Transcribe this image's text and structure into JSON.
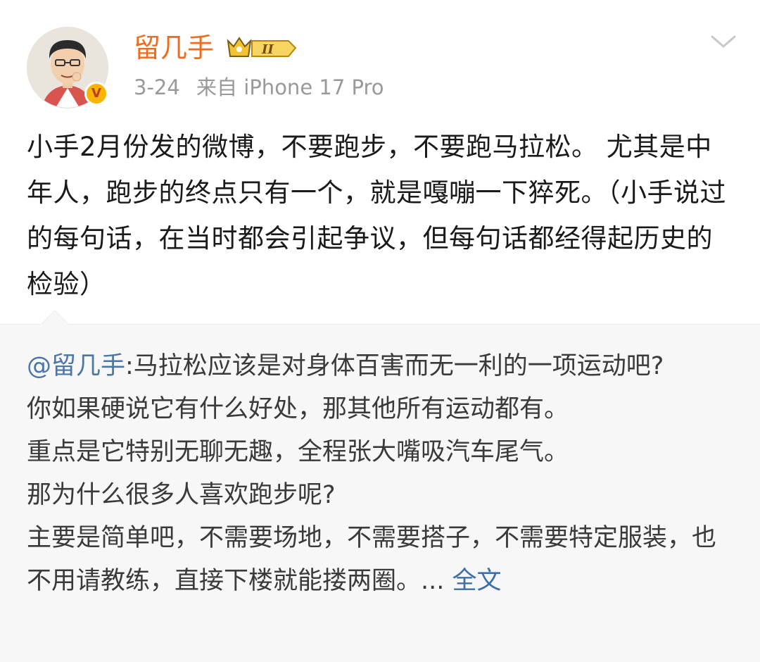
{
  "post": {
    "username": "留几手",
    "vip_level": "II",
    "verified_mark": "V",
    "date": "3-24",
    "source": "来自 iPhone 17 Pro",
    "body": "小手2月份发的微博，不要跑步，不要跑马拉松。 尤其是中年人，跑步的终点只有一个，就是嘎嘣一下猝死。（小手说过的每句话，在当时都会引起争议，但每句话都经得起历史的检验）"
  },
  "quote": {
    "mention": "@留几手",
    "lines": [
      ":马拉松应该是对身体百害而无一利的一项运动吧?",
      "你如果硬说它有什么好处，那其他所有运动都有。",
      "重点是它特别无聊无趣，全程张大嘴吸汽车尾气。",
      "那为什么很多人喜欢跑步呢?",
      "主要是简单吧，不需要场地，不需要搭子，不需要特定服装，也不用请教练，直接下楼就能搂两圈。... "
    ],
    "more_label": "全文"
  },
  "icons": {
    "avatar": "avatar-illustration",
    "verified": "verified-v-icon",
    "vip": "vip-crown-icon",
    "menu": "chevron-down-icon"
  },
  "colors": {
    "username": "#f26b1d",
    "meta": "#999999",
    "link": "#4a76a8",
    "quote_bg": "#f7f7f7"
  }
}
